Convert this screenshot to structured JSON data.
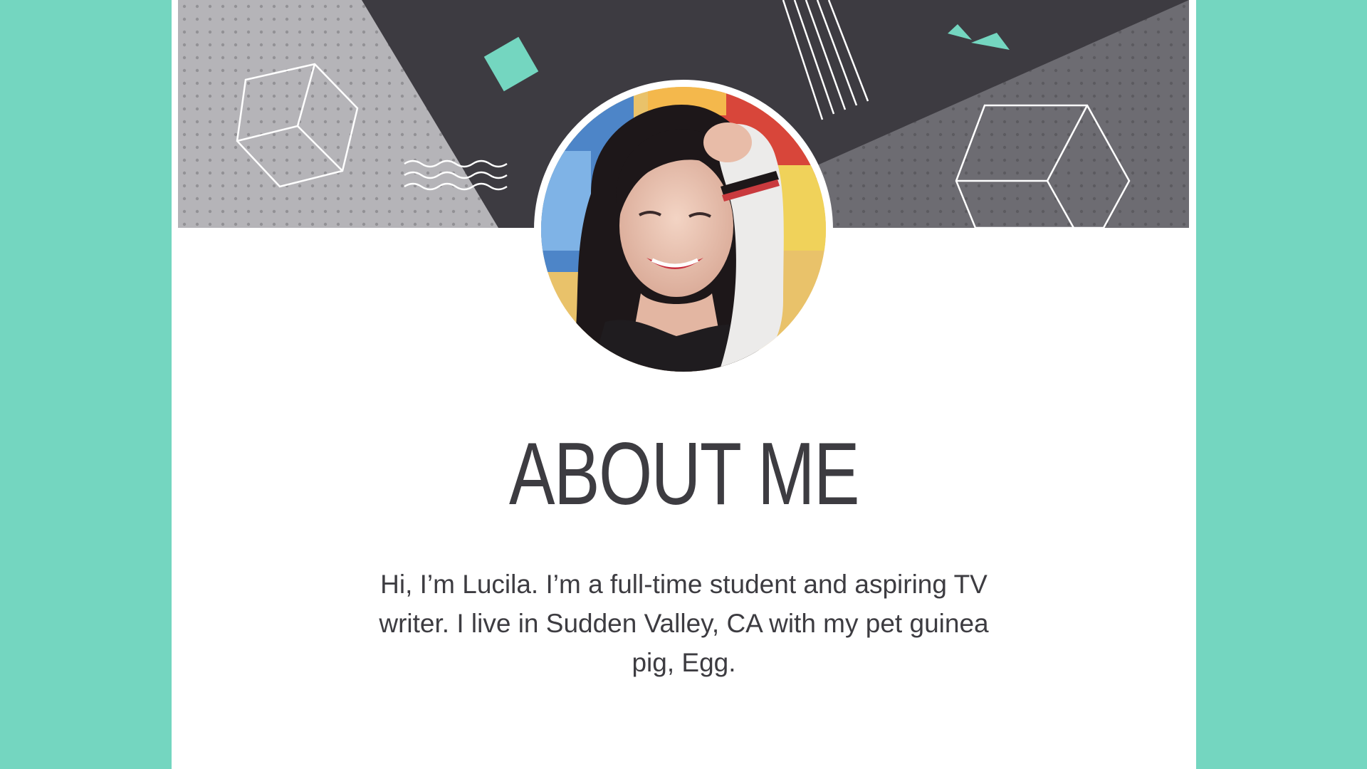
{
  "slide": {
    "title": "ABOUT ME",
    "bio": "Hi, I’m Lucila. I’m a full-time student and aspiring TV writer. I live in Sudden Valley, CA with my pet guinea pig, Egg."
  },
  "colors": {
    "background": "#74d6c0",
    "page": "#ffffff",
    "dark_shape": "#3d3b41",
    "light_gray": "#b5b4b8",
    "mid_gray": "#6d6c72",
    "accent": "#74d6c0",
    "text": "#3d3c41"
  },
  "icons": [
    "cube-outline-icon",
    "wave-lines-icon",
    "teal-square-icon",
    "diagonal-lines-icon",
    "teal-triangles-icon",
    "hexagon-cube-icon"
  ]
}
